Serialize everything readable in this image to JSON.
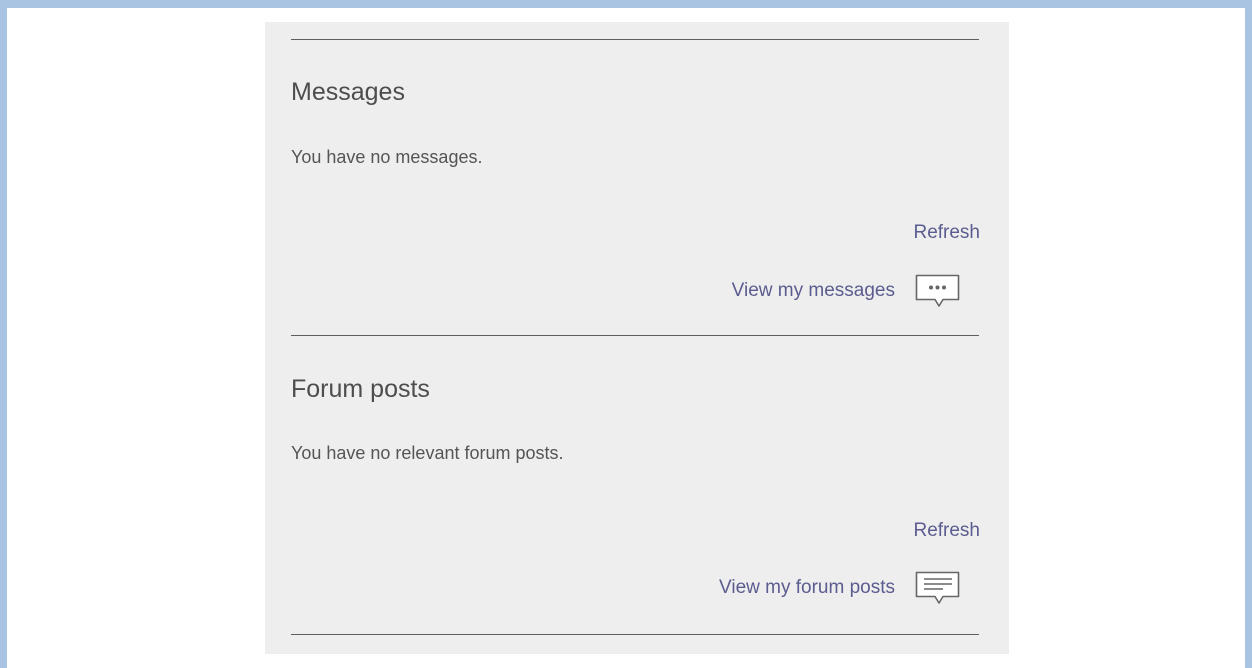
{
  "messages": {
    "heading": "Messages",
    "empty_text": "You have no messages.",
    "refresh_label": "Refresh",
    "view_label": "View my messages",
    "view_icon": "message-bubble-dots-icon"
  },
  "forum": {
    "heading": "Forum posts",
    "empty_text": "You have no relevant forum posts.",
    "refresh_label": "Refresh",
    "view_label": "View my forum posts",
    "view_icon": "forum-bubble-lines-icon"
  },
  "colors": {
    "link": "#5b5c8f",
    "panel_bg": "#eeeeee",
    "frame_border": "#a9c4e2",
    "divider": "#5f6061"
  }
}
